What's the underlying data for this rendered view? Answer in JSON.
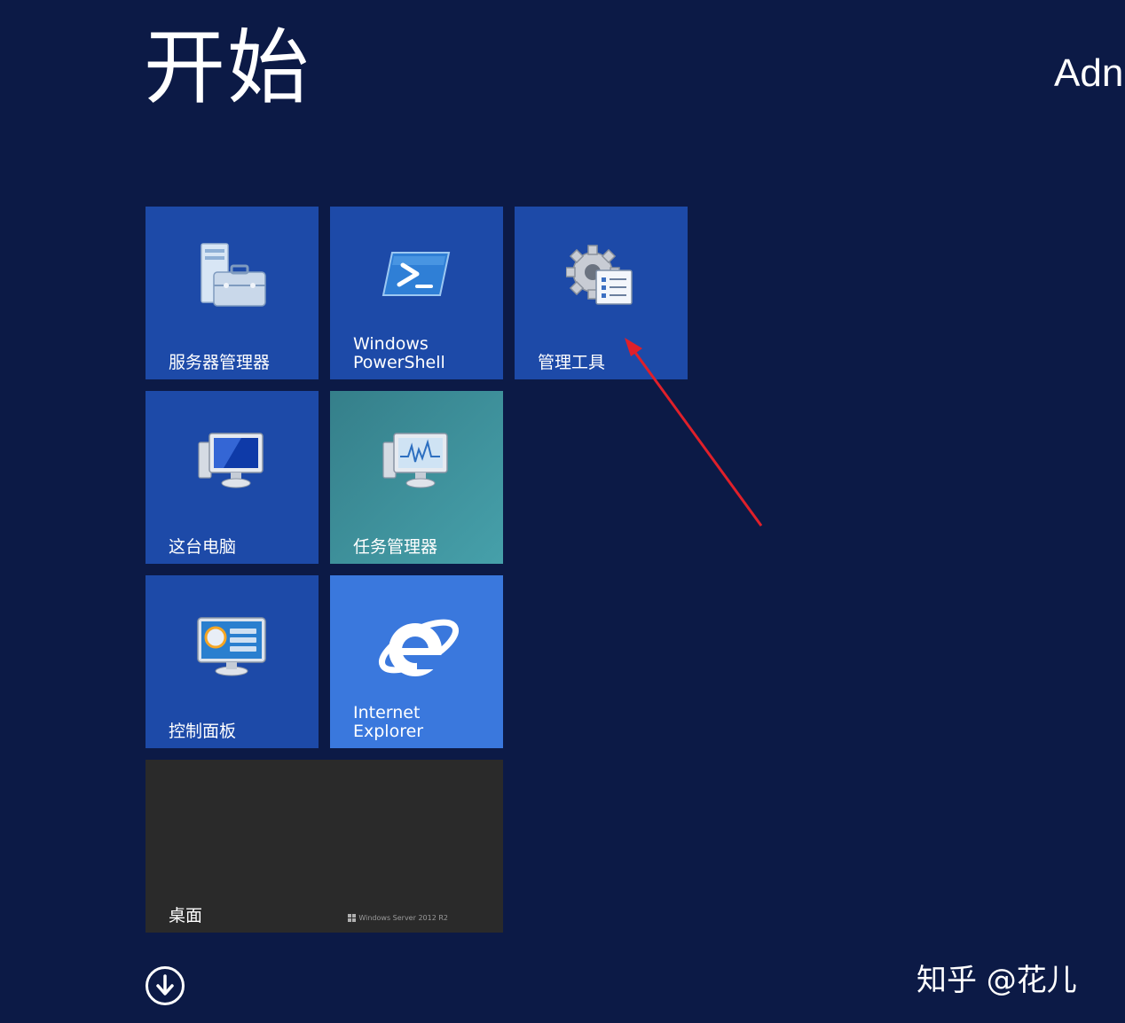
{
  "start_screen": {
    "title": "开始",
    "user": "Adn"
  },
  "tiles": [
    {
      "id": "server-manager",
      "label": [
        "服务器管理器"
      ],
      "icon": "server-manager-icon"
    },
    {
      "id": "powershell",
      "label": [
        "Windows",
        "PowerShell"
      ],
      "icon": "powershell-icon"
    },
    {
      "id": "admin-tools",
      "label": [
        "管理工具"
      ],
      "icon": "admin-tools-icon"
    },
    {
      "id": "this-pc",
      "label": [
        "这台电脑"
      ],
      "icon": "computer-icon"
    },
    {
      "id": "task-manager",
      "label": [
        "任务管理器"
      ],
      "icon": "task-manager-icon"
    },
    {
      "id": "control-panel",
      "label": [
        "控制面板"
      ],
      "icon": "control-panel-icon"
    },
    {
      "id": "internet-explorer",
      "label": [
        "Internet",
        "Explorer"
      ],
      "icon": "internet-explorer-icon"
    },
    {
      "id": "desktop",
      "label": [
        "桌面"
      ],
      "icon": "windows-logo-icon"
    }
  ],
  "desktop_tile": {
    "os_text": "Windows Server 2012 R2"
  },
  "watermark": "知乎 @花儿",
  "colors": {
    "background": "#0c1a46",
    "tile_blue": "#1d4aa8",
    "tile_teal": "#3f8f9a",
    "tile_ie": "#3a78dd",
    "tile_desktop": "#2a2a2a",
    "annotation_arrow": "#e0202a"
  }
}
